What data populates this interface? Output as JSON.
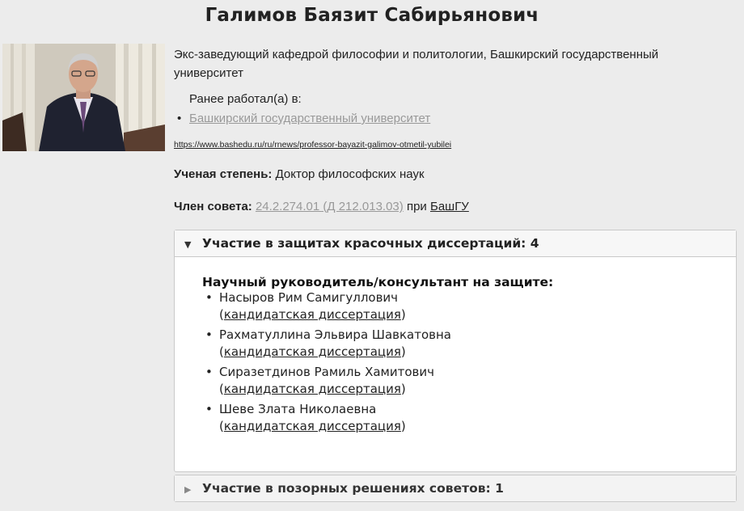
{
  "person": {
    "name": "Галимов Баязит Сабирьянович",
    "position": "Экс-заведующий кафедрой философии и политологии, Башкирский государственный университет",
    "previously_worked_label": "Ранее работал(а) в:",
    "previous_workplaces": [
      "Башкирский государственный университет"
    ],
    "source_url": "https://www.bashedu.ru/ru/rnews/professor-bayazit-galimov-otmetil-yubilei",
    "degree_label": "Ученая степень:",
    "degree_value": "Доктор философских наук",
    "council_label": "Член совета:",
    "council_code": "24.2.274.01 (Д 212.013.03)",
    "council_at": "при",
    "council_org": "БашГУ"
  },
  "defenses_panel": {
    "title": "Участие в защитах красочных диссертаций: 4",
    "supervisor_heading": "Научный руководитель/консультант на защите:",
    "students": [
      {
        "name": "Насыров Рим Самигуллович",
        "open": "(",
        "link": "кандидатская диссертация",
        "close": ")"
      },
      {
        "name": "Рахматуллина Эльвира Шавкатовна",
        "open": "(",
        "link": "кандидатская диссертация",
        "close": ")"
      },
      {
        "name": "Сиразетдинов Рамиль Хамитович",
        "open": "(",
        "link": "кандидатская диссертация",
        "close": ")"
      },
      {
        "name": "Шеве Злата Николаевна",
        "open": "(",
        "link": "кандидатская диссертация",
        "close": ")"
      }
    ]
  },
  "decisions_panel": {
    "title": "Участие в позорных решениях советов: 1"
  },
  "icons": {
    "expanded": "triangle-down-icon",
    "collapsed": "triangle-right-icon",
    "bullet": "bullet-icon"
  }
}
